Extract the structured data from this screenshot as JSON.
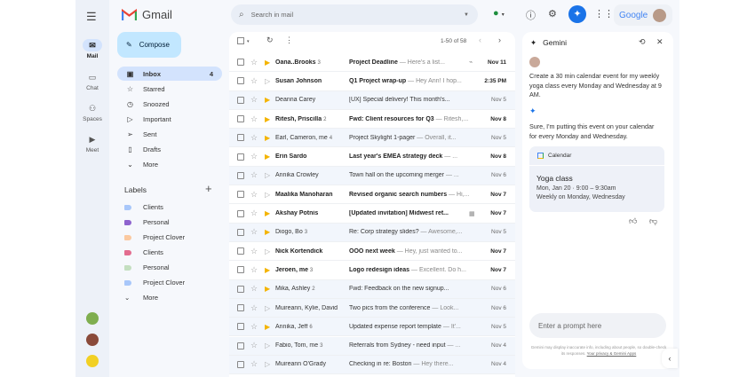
{
  "app": {
    "name": "Gmail"
  },
  "rail": {
    "items": [
      {
        "label": "Mail",
        "icon": "mail-icon"
      },
      {
        "label": "Chat",
        "icon": "chat-icon"
      },
      {
        "label": "Spaces",
        "icon": "spaces-icon"
      },
      {
        "label": "Meet",
        "icon": "meet-icon"
      }
    ]
  },
  "compose_label": "Compose",
  "nav": [
    {
      "label": "Inbox",
      "count": "4",
      "icon": "inbox-icon"
    },
    {
      "label": "Starred",
      "icon": "star-icon"
    },
    {
      "label": "Snoozed",
      "icon": "clock-icon"
    },
    {
      "label": "Important",
      "icon": "important-icon"
    },
    {
      "label": "Sent",
      "icon": "send-icon"
    },
    {
      "label": "Drafts",
      "icon": "draft-icon"
    },
    {
      "label": "More",
      "icon": "chevron-down-icon"
    }
  ],
  "labels": {
    "title": "Labels",
    "items": [
      {
        "label": "Clients",
        "color": "#a8c7fa"
      },
      {
        "label": "Personal",
        "color": "#8e63ce"
      },
      {
        "label": "Project Clover",
        "color": "#fbc9a0"
      },
      {
        "label": "Clients",
        "color": "#e36d8f"
      },
      {
        "label": "Personal",
        "color": "#c4dfc0"
      },
      {
        "label": "Project Clover",
        "color": "#a8c7fa"
      }
    ],
    "more": "More"
  },
  "search": {
    "placeholder": "Search in mail"
  },
  "header": {
    "account_brand": "Google"
  },
  "toolbar": {
    "pagination": "1-50 of 58"
  },
  "emails": [
    {
      "sender": "Oana..Brooks",
      "count": "3",
      "subject": "Project Deadline",
      "snippet": "Here's a list...",
      "date": "Nov 11",
      "unread": true,
      "important": true,
      "icon": "attachment-icon"
    },
    {
      "sender": "Susan Johnson",
      "count": "",
      "subject": "Q1 Project wrap-up",
      "snippet": "Hey Ann! I hop...",
      "date": "2:35 PM",
      "unread": true,
      "important": false
    },
    {
      "sender": "Deanna Carey",
      "count": "",
      "subject": "[UX] Special delivery! This month's...",
      "snippet": "",
      "date": "Nov 5",
      "unread": false,
      "important": true
    },
    {
      "sender": "Ritesh, Priscilla",
      "count": "2",
      "subject": "Fwd: Client resources for Q3",
      "snippet": "Ritesh,...",
      "date": "Nov 8",
      "unread": true,
      "important": true
    },
    {
      "sender": "Earl, Cameron, me",
      "count": "4",
      "subject": "Project Skylight 1-pager",
      "snippet": "Overall, it...",
      "date": "Nov 5",
      "unread": false,
      "important": true
    },
    {
      "sender": "Erin Sardo",
      "count": "",
      "subject": "Last year's EMEA strategy deck",
      "snippet": "...",
      "date": "Nov 8",
      "unread": true,
      "important": true
    },
    {
      "sender": "Annika Crowley",
      "count": "",
      "subject": "Town hall on the upcoming merger",
      "snippet": "...",
      "date": "Nov 6",
      "unread": false,
      "important": false
    },
    {
      "sender": "Maalika Manoharan",
      "count": "",
      "subject": "Revised organic search numbers",
      "snippet": "Hi,...",
      "date": "Nov 7",
      "unread": true,
      "important": false
    },
    {
      "sender": "Akshay Potnis",
      "count": "",
      "subject": "[Updated invitation] Midwest ret...",
      "snippet": "",
      "date": "Nov 7",
      "unread": true,
      "important": true,
      "icon": "calendar-icon"
    },
    {
      "sender": "Diogo, Bo",
      "count": "3",
      "subject": "Re: Corp strategy slides?",
      "snippet": "Awesome,...",
      "date": "Nov 5",
      "unread": false,
      "important": true
    },
    {
      "sender": "Nick Kortendick",
      "count": "",
      "subject": "OOO next week",
      "snippet": "Hey, just wanted to...",
      "date": "Nov 7",
      "unread": true,
      "important": false
    },
    {
      "sender": "Jeroen, me",
      "count": "3",
      "subject": "Logo redesign ideas",
      "snippet": "Excellent. Do h...",
      "date": "Nov 7",
      "unread": true,
      "important": true
    },
    {
      "sender": "Mika, Ashley",
      "count": "2",
      "subject": "Fwd: Feedback on the new signup...",
      "snippet": "",
      "date": "Nov 6",
      "unread": false,
      "important": true
    },
    {
      "sender": "Muireann, Kylie, David",
      "count": "",
      "subject": "Two pics from the conference",
      "snippet": "Look...",
      "date": "Nov 6",
      "unread": false,
      "important": false
    },
    {
      "sender": "Annika, Jeff",
      "count": "6",
      "subject": "Updated expense report template",
      "snippet": "It'...",
      "date": "Nov 5",
      "unread": false,
      "important": true
    },
    {
      "sender": "Fabio, Tom, me",
      "count": "3",
      "subject": "Referrals from Sydney - need input",
      "snippet": "...",
      "date": "Nov 4",
      "unread": false,
      "important": false
    },
    {
      "sender": "Muireann O'Grady",
      "count": "",
      "subject": "Checking in re: Boston",
      "snippet": "Hey there...",
      "date": "Nov 4",
      "unread": false,
      "important": false
    }
  ],
  "gemini": {
    "title": "Gemini",
    "user_prompt": "Create a 30 min calendar event for my weekly yoga class every Monday and Wednesday at 9 AM.",
    "response": "Sure, I'm putting this event on your calendar for every Monday and Wednesday.",
    "card": {
      "app": "Calendar",
      "event_title": "Yoga class",
      "time": "Mon, Jan 20 · 9:00 – 9:30am",
      "recurrence": "Weekly on Monday, Wednesday"
    },
    "input_placeholder": "Enter a prompt here",
    "disclaimer": "Gemini may display inaccurate info, including about people, so double-check its responses.",
    "privacy_link": "Your privacy & Gemini Apps"
  },
  "colors": {
    "important": "#f4b400",
    "accent": "#1a73e8",
    "selected_nav": "#d3e3fd",
    "compose": "#c2e7ff"
  }
}
